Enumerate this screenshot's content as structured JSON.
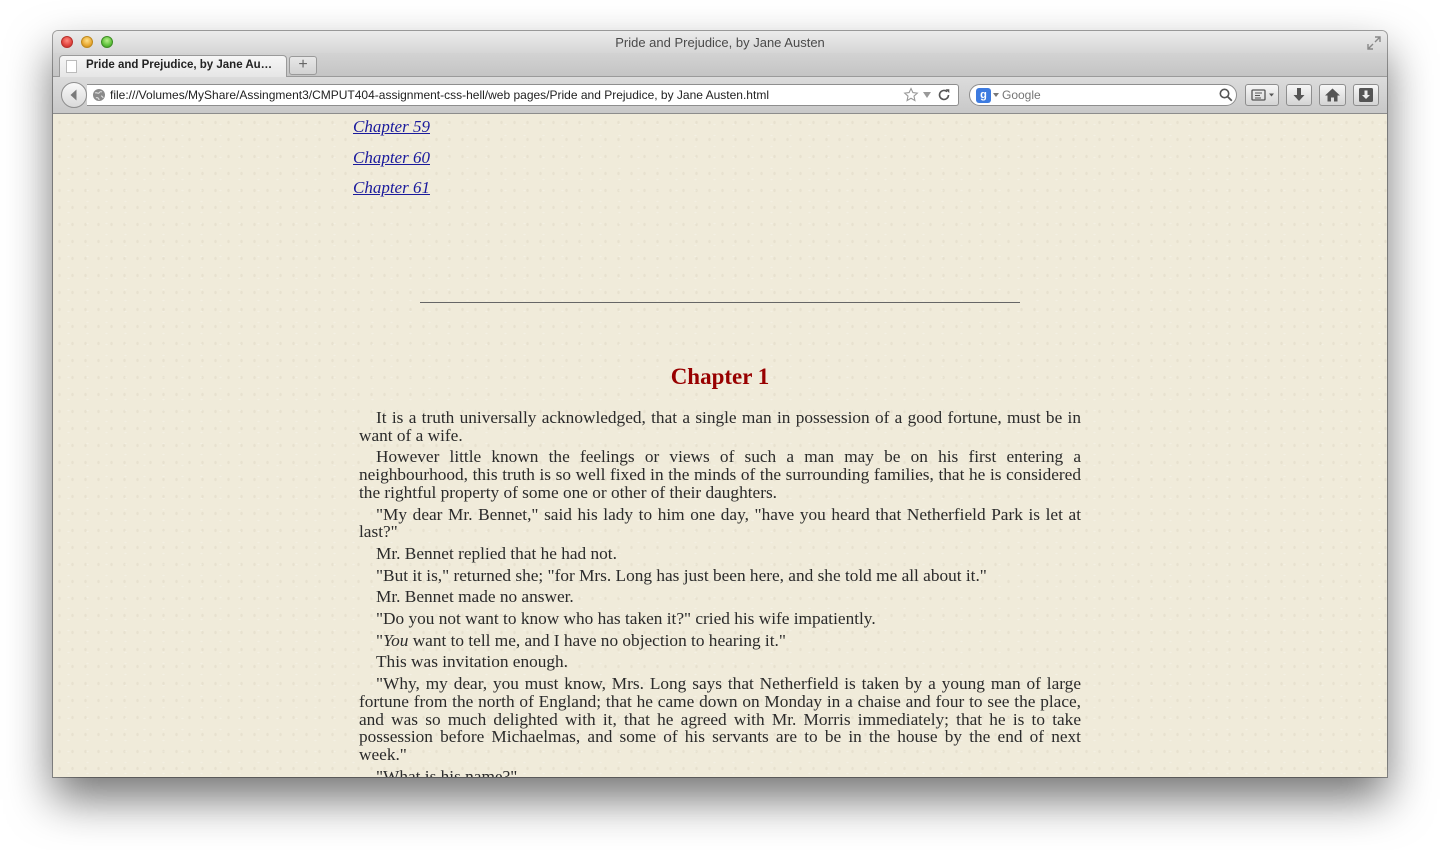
{
  "window": {
    "title": "Pride and Prejudice, by Jane Austen"
  },
  "tab": {
    "label": "Pride and Prejudice, by Jane Au…",
    "new_tab_symbol": "+"
  },
  "navbar": {
    "url": "file:///Volumes/MyShare/Assingment3/CMPUT404-assignment-css-hell/web pages/Pride and Prejudice, by Jane Austen.html",
    "search_placeholder": "Google"
  },
  "toc": [
    "Chapter 59",
    "Chapter 60",
    "Chapter 61"
  ],
  "chapter": {
    "heading": "Chapter 1",
    "paragraphs": [
      {
        "before": "It is a truth universally acknowledged, that a single man in possession of a good fortune, must be in want of a wife.",
        "em": "",
        "after": ""
      },
      {
        "before": "However little known the feelings or views of such a man may be on his first entering a neighbourhood, this truth is so well fixed in the minds of the surrounding families, that he is considered the rightful property of some one or other of their daughters.",
        "em": "",
        "after": ""
      },
      {
        "before": "\"My dear Mr. Bennet,\" said his lady to him one day, \"have you heard that Netherfield Park is let at last?\"",
        "em": "",
        "after": ""
      },
      {
        "before": "Mr. Bennet replied that he had not.",
        "em": "",
        "after": ""
      },
      {
        "before": "\"But it is,\" returned she; \"for Mrs. Long has just been here, and she told me all about it.\"",
        "em": "",
        "after": ""
      },
      {
        "before": "Mr. Bennet made no answer.",
        "em": "",
        "after": ""
      },
      {
        "before": "\"Do you not want to know who has taken it?\" cried his wife impatiently.",
        "em": "",
        "after": ""
      },
      {
        "before": "\"",
        "em": "You",
        "after": " want to tell me, and I have no objection to hearing it.\""
      },
      {
        "before": "This was invitation enough.",
        "em": "",
        "after": ""
      },
      {
        "before": "\"Why, my dear, you must know, Mrs. Long says that Netherfield is taken by a young man of large fortune from the north of England; that he came down on Monday in a chaise and four to see the place, and was so much delighted with it, that he agreed with Mr. Morris immediately; that he is to take possession before Michaelmas, and some of his servants are to be in the house by the end of next week.\"",
        "em": "",
        "after": ""
      },
      {
        "before": "\"What is his name?\"",
        "em": "",
        "after": ""
      }
    ]
  }
}
